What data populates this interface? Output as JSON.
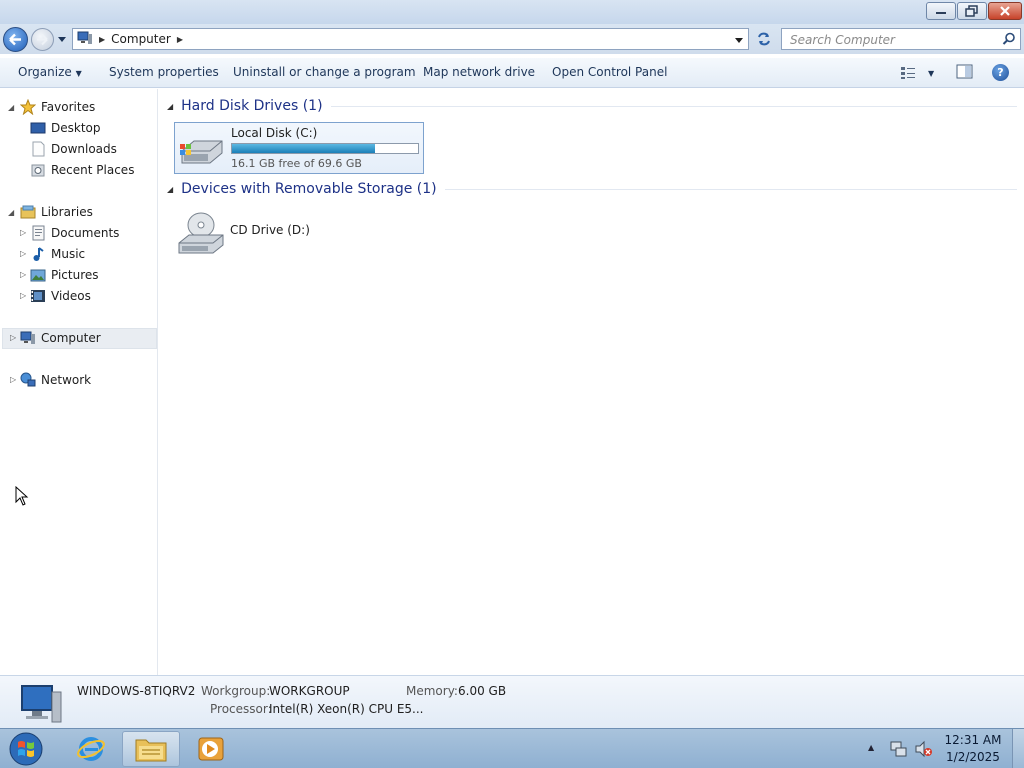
{
  "address_bar": {
    "breadcrumb": "Computer",
    "search_placeholder": "Search Computer"
  },
  "toolbar": {
    "organize": "Organize",
    "system_properties": "System properties",
    "uninstall": "Uninstall or change a program",
    "map_network_drive": "Map network drive",
    "open_control_panel": "Open Control Panel",
    "help_glyph": "?"
  },
  "nav_pane": {
    "favorites": {
      "label": "Favorites",
      "items": [
        "Desktop",
        "Downloads",
        "Recent Places"
      ]
    },
    "libraries": {
      "label": "Libraries",
      "items": [
        "Documents",
        "Music",
        "Pictures",
        "Videos"
      ]
    },
    "computer": "Computer",
    "network": "Network"
  },
  "content": {
    "hard_disk_group": "Hard Disk Drives (1)",
    "removable_group": "Devices with Removable Storage (1)",
    "drives": [
      {
        "name": "Local Disk (C:)",
        "free_text": "16.1 GB free of 69.6 GB",
        "used_fraction": 0.77
      },
      {
        "name": "CD Drive (D:)"
      }
    ]
  },
  "details": {
    "computer_name": "WINDOWS-8TIQRV2",
    "workgroup_label": "Workgroup:",
    "workgroup": "WORKGROUP",
    "memory_label": "Memory:",
    "memory": "6.00 GB",
    "processor_label": "Processor:",
    "processor": "Intel(R) Xeon(R) CPU E5..."
  },
  "taskbar": {
    "time": "12:31 AM",
    "date": "1/2/2025"
  },
  "colors": {
    "accent": "#1e3287",
    "disk_bar": "#1b7fb8",
    "taskbar": "#8fb0d1"
  }
}
